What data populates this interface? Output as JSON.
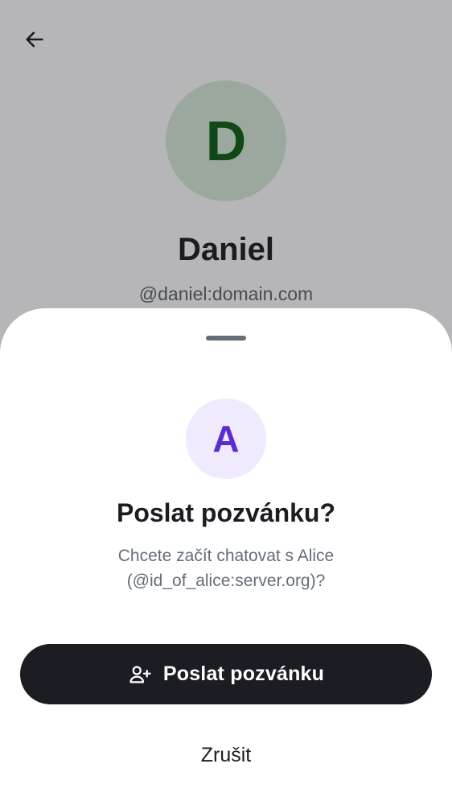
{
  "profile": {
    "back_icon": "arrow-left-icon",
    "avatar_letter": "D",
    "name": "Daniel",
    "user_id": "@daniel:domain.com"
  },
  "sheet": {
    "avatar_letter": "A",
    "title": "Poslat pozvánku?",
    "subtitle": "Chcete začít chatovat s Alice (@id_of_alice:server.org)?",
    "primary_button": {
      "label": "Poslat pozvánku",
      "icon": "user-add-icon"
    },
    "cancel_label": "Zrušit"
  },
  "colors": {
    "profile_avatar_bg": "#d7ead7",
    "profile_avatar_fg": "#0b5d12",
    "sheet_avatar_bg": "#efeafd",
    "sheet_avatar_fg": "#5a2bd1",
    "primary_button_bg": "#1b1d22",
    "scrim": "rgba(27,29,34,0.32)"
  }
}
